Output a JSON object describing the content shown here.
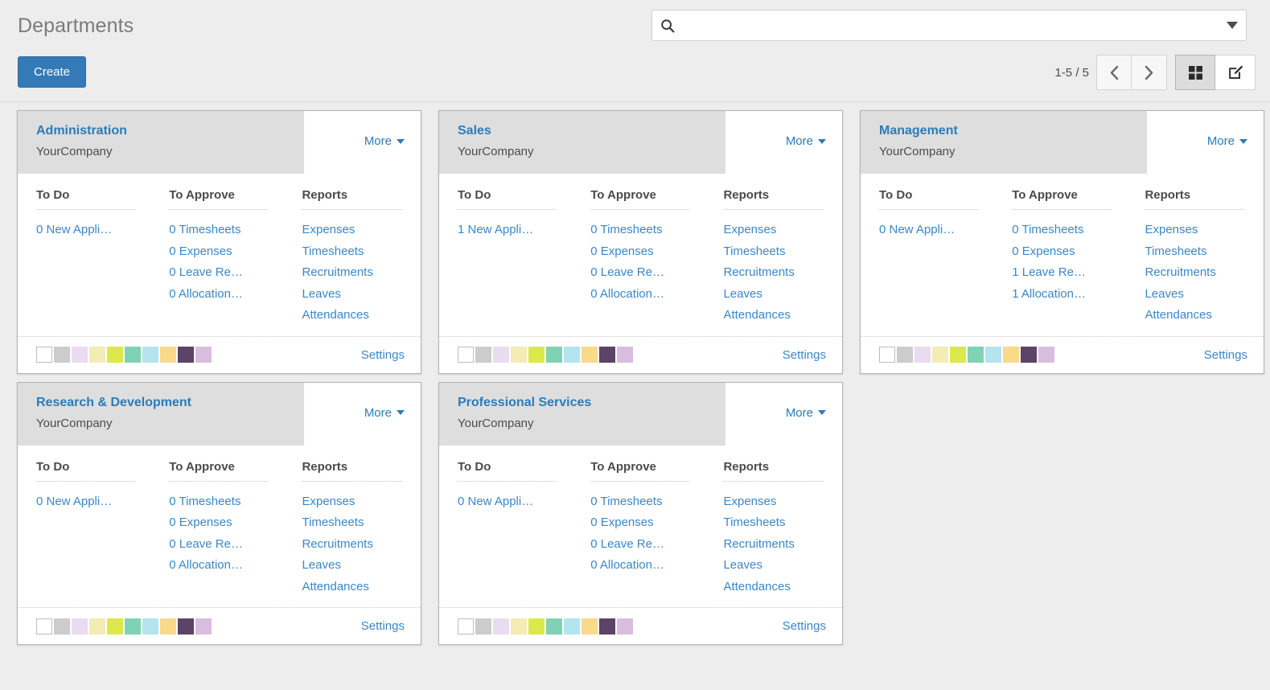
{
  "header": {
    "title": "Departments",
    "create_label": "Create"
  },
  "search": {
    "value": "",
    "placeholder": "",
    "icon": "search-icon",
    "caret_icon": "chevron-down-icon"
  },
  "pager": {
    "count": "1-5 / 5",
    "prev_icon": "chevron-left-icon",
    "next_icon": "chevron-right-icon"
  },
  "views": [
    {
      "name": "kanban",
      "icon": "kanban-grid-icon",
      "active": true
    },
    {
      "name": "list",
      "icon": "edit-list-icon",
      "active": false
    }
  ],
  "labels": {
    "more": "More",
    "settings": "Settings",
    "col_todo": "To Do",
    "col_approve": "To Approve",
    "col_reports": "Reports",
    "company": "YourCompany"
  },
  "colors": {
    "brand_blue": "#337ab7",
    "link_blue": "#3a87c8",
    "title_blue": "#2b7cb8",
    "page_bg": "#ededed",
    "card_head_bg": "#dedede"
  },
  "swatch_palette": [
    "#ffffff",
    "#cccccc",
    "#eadcf0",
    "#f3ecb4",
    "#dbe94a",
    "#7fd2b4",
    "#b4e4ef",
    "#f9d98a",
    "#5c4368",
    "#d9bddf"
  ],
  "cards": [
    {
      "title": "Administration",
      "company": "YourCompany",
      "todo": [
        "0 New Appli…"
      ],
      "approve": [
        "0 Timesheets",
        "0 Expenses",
        "0 Leave Re…",
        "0 Allocation…"
      ],
      "reports": [
        "Expenses",
        "Timesheets",
        "Recruitments",
        "Leaves",
        "Attendances"
      ]
    },
    {
      "title": "Sales",
      "company": "YourCompany",
      "todo": [
        "1 New Appli…"
      ],
      "approve": [
        "0 Timesheets",
        "0 Expenses",
        "0 Leave Re…",
        "0 Allocation…"
      ],
      "reports": [
        "Expenses",
        "Timesheets",
        "Recruitments",
        "Leaves",
        "Attendances"
      ]
    },
    {
      "title": "Management",
      "company": "YourCompany",
      "todo": [
        "0 New Appli…"
      ],
      "approve": [
        "0 Timesheets",
        "0 Expenses",
        "1 Leave Re…",
        "1 Allocation…"
      ],
      "reports": [
        "Expenses",
        "Timesheets",
        "Recruitments",
        "Leaves",
        "Attendances"
      ]
    },
    {
      "title": "Research & Development",
      "company": "YourCompany",
      "todo": [
        "0 New Appli…"
      ],
      "approve": [
        "0 Timesheets",
        "0 Expenses",
        "0 Leave Re…",
        "0 Allocation…"
      ],
      "reports": [
        "Expenses",
        "Timesheets",
        "Recruitments",
        "Leaves",
        "Attendances"
      ]
    },
    {
      "title": "Professional Services",
      "company": "YourCompany",
      "todo": [
        "0 New Appli…"
      ],
      "approve": [
        "0 Timesheets",
        "0 Expenses",
        "0 Leave Re…",
        "0 Allocation…"
      ],
      "reports": [
        "Expenses",
        "Timesheets",
        "Recruitments",
        "Leaves",
        "Attendances"
      ]
    }
  ]
}
